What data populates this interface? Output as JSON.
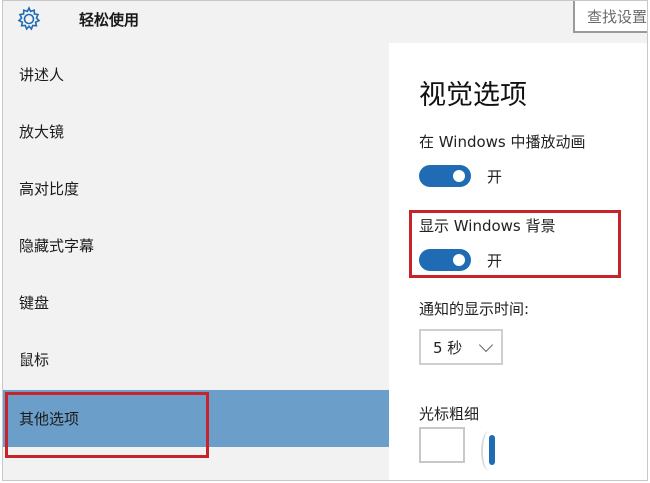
{
  "header": {
    "title": "轻松使用",
    "search_placeholder": "查找设置",
    "icon": "gear-icon"
  },
  "sidebar": {
    "items": [
      {
        "label": "讲述人"
      },
      {
        "label": "放大镜"
      },
      {
        "label": "高对比度"
      },
      {
        "label": "隐藏式字幕"
      },
      {
        "label": "键盘"
      },
      {
        "label": "鼠标"
      },
      {
        "label": "其他选项",
        "selected": true
      }
    ]
  },
  "content": {
    "section_title": "视觉选项",
    "animations_label": "在 Windows 中播放动画",
    "animations_state": "开",
    "background_label": "显示 Windows 背景",
    "background_state": "开",
    "notification_label": "通知的显示时间:",
    "notification_value": "5 秒",
    "cursor_label": "光标粗细"
  },
  "colors": {
    "accent": "#1f6cb5",
    "selected_nav": "#6b9ec8",
    "highlight": "#c8232a"
  }
}
